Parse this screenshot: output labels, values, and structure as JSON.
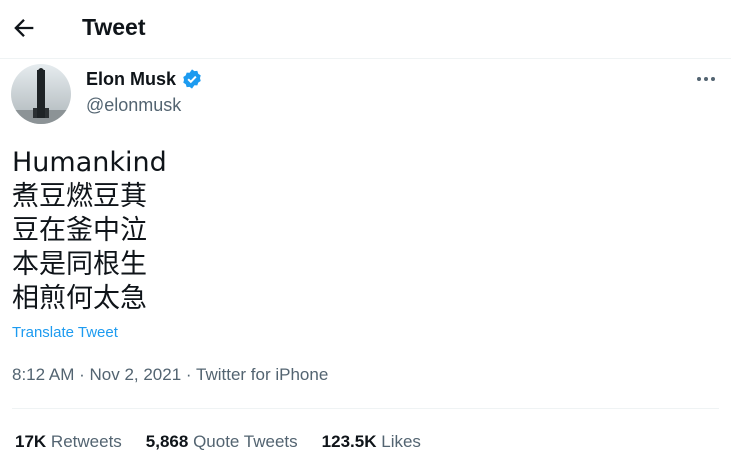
{
  "header": {
    "title": "Tweet",
    "back_icon": "arrow-left-icon"
  },
  "author": {
    "name": "Elon Musk",
    "handle": "@elonmusk",
    "verified": true,
    "verified_color": "#1d9bf0"
  },
  "tweet": {
    "lines": [
      "Humankind",
      "煮豆燃豆萁",
      "豆在釜中泣",
      "本是同根生",
      "相煎何太急"
    ],
    "translate_label": "Translate Tweet"
  },
  "meta": {
    "time": "8:12 AM",
    "date": "Nov 2, 2021",
    "source": "Twitter for iPhone"
  },
  "stats": {
    "retweets_count": "17K",
    "retweets_label": "Retweets",
    "quotes_count": "5,868",
    "quotes_label": "Quote Tweets",
    "likes_count": "123.5K",
    "likes_label": "Likes"
  },
  "colors": {
    "accent": "#1d9bf0",
    "text": "#0f1419",
    "secondary": "#536471"
  }
}
